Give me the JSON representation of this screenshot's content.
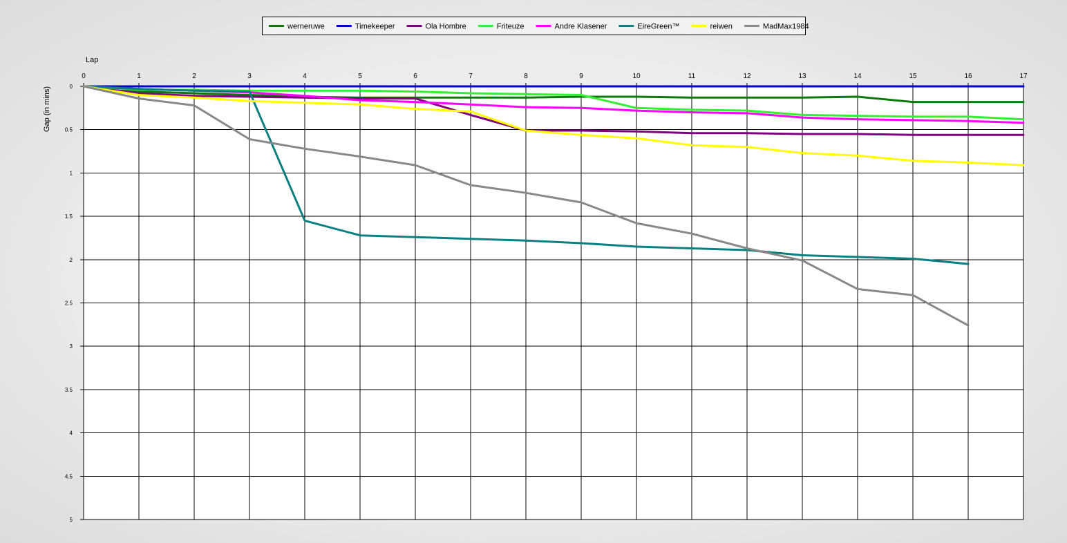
{
  "chart_data": {
    "type": "line",
    "xlabel": "Lap",
    "ylabel": "Gap (in mins)",
    "xlim": [
      0,
      17
    ],
    "ylim": [
      0,
      5
    ],
    "y_inverted": true,
    "x_axis_position": "top",
    "grid": true,
    "legend_position": "top-center",
    "x_ticks": [
      0,
      1,
      2,
      3,
      4,
      5,
      6,
      7,
      8,
      9,
      10,
      11,
      12,
      13,
      14,
      15,
      16,
      17
    ],
    "y_ticks": [
      0,
      0.5,
      1,
      1.5,
      2,
      2.5,
      3,
      3.5,
      4,
      4.5,
      5
    ],
    "y_tick_labels": [
      "0",
      "0.5",
      "1",
      "1.5",
      "2",
      "2.5",
      "3",
      "3.5",
      "4",
      "4.5",
      "5"
    ],
    "series": [
      {
        "name": "werneruwe",
        "color": "#0b7a0b",
        "x": [
          0,
          1,
          2,
          3,
          4,
          5,
          6,
          7,
          8,
          9,
          10,
          11,
          12,
          13,
          14,
          15,
          16,
          17
        ],
        "y": [
          0,
          0.06,
          0.08,
          0.1,
          0.12,
          0.13,
          0.13,
          0.13,
          0.13,
          0.12,
          0.12,
          0.13,
          0.13,
          0.13,
          0.12,
          0.18,
          0.18,
          0.18
        ]
      },
      {
        "name": "Timekeeper",
        "color": "#0000cc",
        "x": [
          0,
          1,
          2,
          3,
          4,
          5,
          6,
          7,
          8,
          9,
          10,
          11,
          12,
          13,
          14,
          15,
          16,
          17
        ],
        "y": [
          0,
          0,
          0,
          0,
          0,
          0,
          0,
          0,
          0,
          0,
          0,
          0,
          0,
          0,
          0,
          0,
          0,
          0
        ]
      },
      {
        "name": "Ola Hombre",
        "color": "#800080",
        "x": [
          0,
          1,
          2,
          3,
          4,
          5,
          6,
          7,
          8,
          9,
          10,
          11,
          12,
          13,
          14,
          15,
          16,
          17
        ],
        "y": [
          0,
          0.08,
          0.11,
          0.12,
          0.13,
          0.14,
          0.14,
          0.33,
          0.51,
          0.51,
          0.52,
          0.54,
          0.54,
          0.55,
          0.55,
          0.56,
          0.56,
          0.56
        ]
      },
      {
        "name": "Friteuze",
        "color": "#33ee33",
        "x": [
          0,
          1,
          2,
          3,
          4,
          5,
          6,
          7,
          8,
          9,
          10,
          11,
          12,
          13,
          14,
          15,
          16,
          17
        ],
        "y": [
          0,
          0.04,
          0.04,
          0.05,
          0.05,
          0.05,
          0.06,
          0.08,
          0.09,
          0.1,
          0.25,
          0.27,
          0.28,
          0.33,
          0.34,
          0.35,
          0.35,
          0.38
        ]
      },
      {
        "name": "Andre Klasener",
        "color": "#ff00ff",
        "x": [
          0,
          1,
          2,
          3,
          4,
          5,
          6,
          7,
          8,
          9,
          10,
          11,
          12,
          13,
          14,
          15,
          16,
          17
        ],
        "y": [
          0,
          0.03,
          0.05,
          0.07,
          0.11,
          0.16,
          0.18,
          0.21,
          0.24,
          0.25,
          0.28,
          0.3,
          0.31,
          0.36,
          0.38,
          0.39,
          0.4,
          0.42
        ]
      },
      {
        "name": "EireGreen™",
        "color": "#0b8080",
        "x": [
          0,
          1,
          2,
          3,
          4,
          5,
          6,
          7,
          8,
          9,
          10,
          11,
          12,
          13,
          14,
          15,
          16
        ],
        "y": [
          0,
          0.03,
          0.05,
          0.06,
          1.55,
          1.72,
          1.74,
          1.76,
          1.78,
          1.81,
          1.85,
          1.87,
          1.89,
          1.95,
          1.97,
          1.99,
          2.05
        ]
      },
      {
        "name": "reiwen",
        "color": "#ffff00",
        "x": [
          0,
          1,
          2,
          3,
          4,
          5,
          6,
          7,
          8,
          9,
          10,
          11,
          12,
          13,
          14,
          15,
          16,
          17
        ],
        "y": [
          0,
          0.1,
          0.13,
          0.17,
          0.19,
          0.21,
          0.26,
          0.29,
          0.51,
          0.56,
          0.6,
          0.68,
          0.7,
          0.77,
          0.8,
          0.86,
          0.88,
          0.91
        ]
      },
      {
        "name": "MadMax1984",
        "color": "#888888",
        "x": [
          0,
          1,
          2,
          3,
          4,
          5,
          6,
          7,
          8,
          9,
          10,
          11,
          12,
          13,
          14,
          15,
          16
        ],
        "y": [
          0,
          0.14,
          0.22,
          0.61,
          0.72,
          0.81,
          0.91,
          1.14,
          1.23,
          1.34,
          1.58,
          1.7,
          1.87,
          2.01,
          2.34,
          2.41,
          2.76
        ]
      }
    ]
  }
}
